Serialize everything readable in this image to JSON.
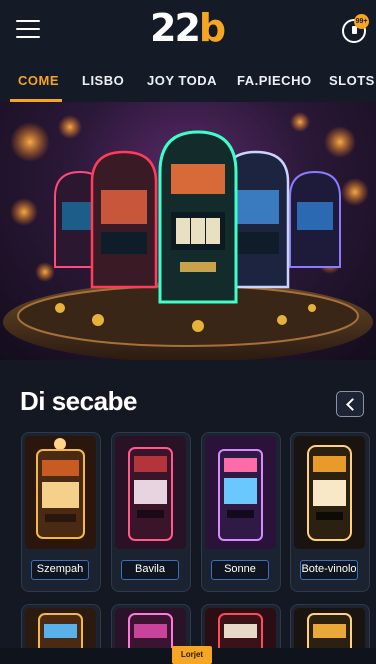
{
  "header": {
    "logo_part1": "22",
    "logo_part2": "b",
    "notification_count": "99+"
  },
  "tabs": [
    {
      "label": "COME",
      "active": true
    },
    {
      "label": "LISBO",
      "active": false
    },
    {
      "label": "JOY TODA",
      "active": false
    },
    {
      "label": "FA.PIECHO",
      "active": false
    },
    {
      "label": "SLOTS",
      "active": false
    }
  ],
  "section": {
    "title": "Di secabe"
  },
  "games": [
    {
      "label": "Szempah"
    },
    {
      "label": "Bavila"
    },
    {
      "label": "Sonne"
    },
    {
      "label": "Bote-vinolo"
    }
  ],
  "footer": {
    "tag": "Lorjet"
  },
  "colors": {
    "accent": "#f5a623",
    "background": "#131822",
    "label_border": "#3d6fb8"
  }
}
